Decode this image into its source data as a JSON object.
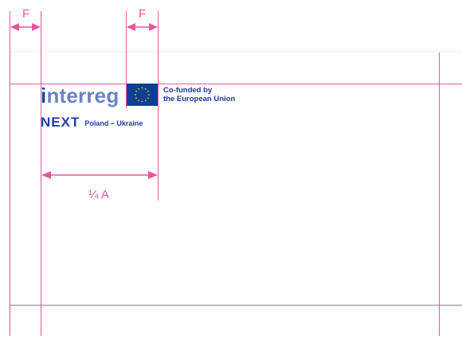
{
  "diagram": {
    "measure_labels": {
      "top_left": "F",
      "top_right": "F",
      "width": "¼ A"
    },
    "logo": {
      "wordmark_first": "i",
      "wordmark_rest": "nterreg",
      "next": "NEXT",
      "region": "Poland – Ukraine"
    },
    "eu": {
      "line1": "Co-funded by",
      "line2": "the European Union"
    },
    "colors": {
      "guide": "#e8559a",
      "brand_dark": "#253da1",
      "brand_light": "#6e81c2",
      "eu_blue": "#0e3f95",
      "eu_star": "#ffcc00"
    }
  }
}
